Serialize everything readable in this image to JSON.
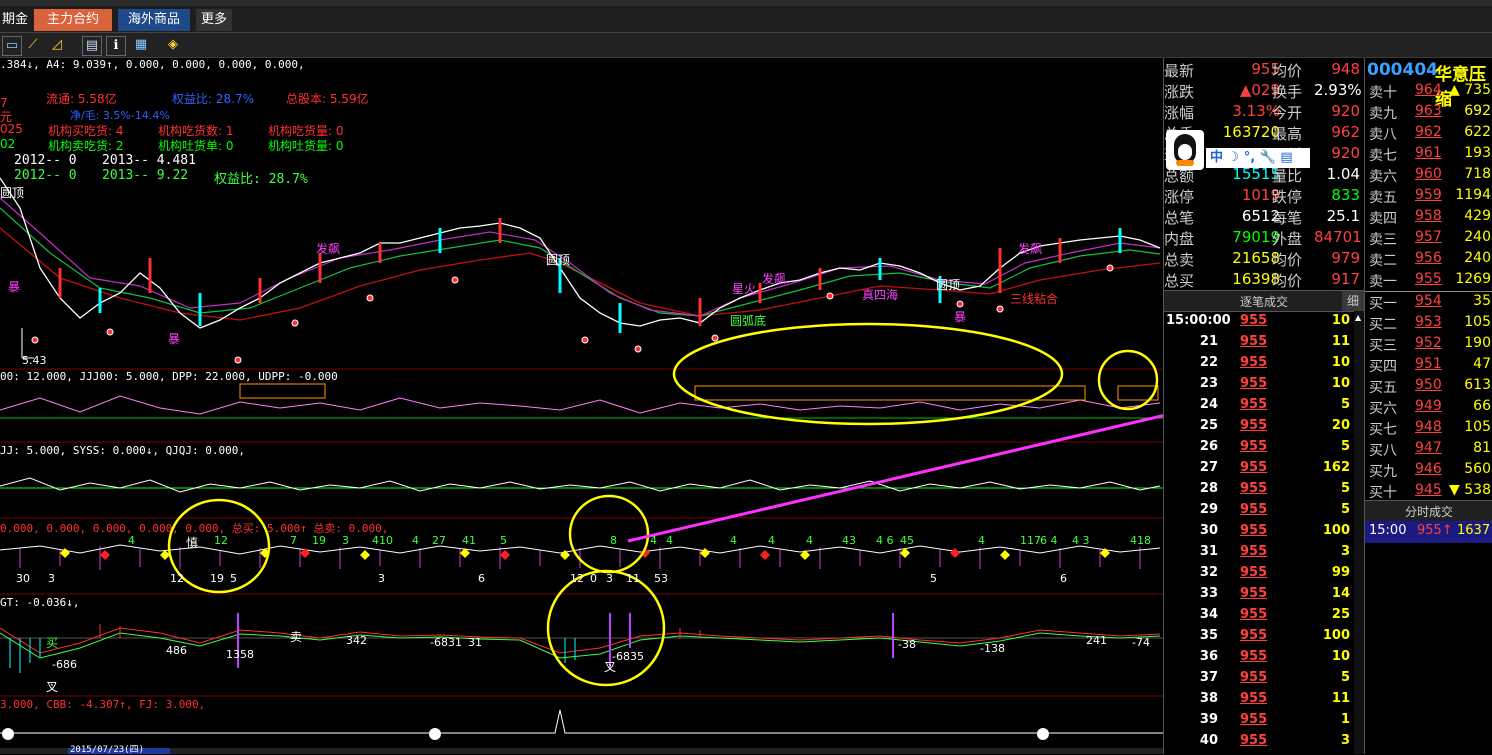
{
  "tabs": [
    {
      "label": "期金",
      "active": false
    },
    {
      "label": "主力合约",
      "active": true
    },
    {
      "label": "海外商品",
      "active": false
    },
    {
      "label": "更多",
      "active": false
    }
  ],
  "chart": {
    "topline": ".384↓, A4: 9.039↑, 0.000, 0.000, 0.000, 0.000,",
    "info": {
      "liutong": "流通: 5.58亿",
      "yiyibi": "权益比: 28.7%",
      "zongguben": "总股本: 5.59亿",
      "jingzi": "净/毛: 3.5%-14.4%",
      "l1": "机构买吃货: 4",
      "l2": "机构吃货数: 1",
      "l3": "机构吃货量: 0",
      "l4": "机构卖吃货: 2",
      "l5": "机构吐货单: 0",
      "l6": "机构吐货量: 0",
      "y1a": "2012-- 0",
      "y1b": "2013-- 4.481",
      "y2a": "2012-- 0",
      "y2b": "2013-- 9.22",
      "y2c": "权益比: 28.7%",
      "left_nums": [
        "7",
        "元",
        "025",
        "02"
      ]
    },
    "labels": {
      "yuanding": "圆顶",
      "fapiao": "发飙",
      "bao": "暴",
      "xinghuo": "星火",
      "yuanhudi": "圆弧底",
      "sanxian": "三线粘合",
      "zhenjia": "真四海",
      "low": "5.43"
    },
    "ind1": "00: 12.000, JJJ00: 5.000, DPP: 22.000, UDPP: -0.000",
    "ind2": "JJ: 5.000, SYSS: 0.000↓, QJQJ: 0.000,",
    "ind3": "0.000, 0.000, 0.000, 0.000, 0.000,  总买: 5.000↑  总卖: 0.000,",
    "ind4": "GT: -0.036↓,",
    "ind5": "3.000, CBB: -4.307↑, FJ: 3.000,",
    "ind3_labels": [
      "慎",
      "12",
      "4",
      "7",
      "19",
      "3",
      "410",
      "4",
      "27",
      "41",
      "5",
      "8",
      "4",
      "4",
      "4",
      "4",
      "4",
      "43",
      "4 6",
      "45",
      "4",
      "117",
      "6 4",
      "4 3",
      "418"
    ],
    "ind3_bottom": [
      "30",
      "3",
      "12",
      "19",
      "5",
      "3",
      "6",
      "12",
      "0",
      "3",
      "11",
      "53",
      "5",
      "6"
    ],
    "ind4_labels": {
      "n1": "-686",
      "n2": "486",
      "n3": "1358",
      "n4": "342",
      "n5": "-6831",
      "n6": "31",
      "n7": "-6835",
      "n8": "-38",
      "n9": "-138",
      "n10": "241",
      "n11": "-74",
      "b1": "买",
      "b2": "卖",
      "b3": "叉",
      "b4": "叉"
    },
    "date_bar": "2015/07/23(四)"
  },
  "quote": {
    "code": "000404",
    "name": "华意压缩",
    "rows": [
      {
        "l1": "最新",
        "v1": "955",
        "c1": "#ff4040",
        "l2": "均价",
        "v2": "948",
        "c2": "#ff4040"
      },
      {
        "l1": "涨跌",
        "v1": "▲029",
        "c1": "#ff4040",
        "l2": "换手",
        "v2": "2.93%",
        "c2": "#ffffff"
      },
      {
        "l1": "涨幅",
        "v1": "3.13%",
        "c1": "#ff4040",
        "l2": "今开",
        "v2": "920",
        "c2": "#ff4040"
      },
      {
        "l1": "总手",
        "v1": "163720",
        "c1": "#ffff00",
        "l2": "最高",
        "v2": "962",
        "c2": "#ff4040"
      },
      {
        "l1": "现手",
        "v1": "",
        "c1": "#ffff00",
        "l2": "最低",
        "v2": "920",
        "c2": "#ff4040"
      },
      {
        "l1": "总额",
        "v1": "15515",
        "c1": "#00ffff",
        "l2": "量比",
        "v2": "1.04",
        "c2": "#ffffff"
      },
      {
        "l1": "涨停",
        "v1": "1019",
        "c1": "#ff4040",
        "l2": "跌停",
        "v2": "833",
        "c2": "#00ff00"
      },
      {
        "l1": "总笔",
        "v1": "6512",
        "c1": "#ffffff",
        "l2": "每笔",
        "v2": "25.1",
        "c2": "#ffffff"
      },
      {
        "l1": "内盘",
        "v1": "79019",
        "c1": "#00ff00",
        "l2": "外盘",
        "v2": "84701",
        "c2": "#ff4040"
      },
      {
        "l1": "总卖",
        "v1": "21658",
        "c1": "#ffff00",
        "l2": "均价",
        "v2": "979",
        "c2": "#ff4040"
      },
      {
        "l1": "总买",
        "v1": "16398",
        "c1": "#ffff00",
        "l2": "均价",
        "v2": "917",
        "c2": "#ff4040"
      }
    ],
    "qq_bar": "中 ☽ °, 🔧 ▤",
    "tick_header": "逐笔成交",
    "tick_detail": "细",
    "ticks": [
      {
        "t": "15:00:00",
        "p": "955",
        "v": "10"
      },
      {
        "t": "21",
        "p": "955",
        "v": "11"
      },
      {
        "t": "22",
        "p": "955",
        "v": "10"
      },
      {
        "t": "23",
        "p": "955",
        "v": "10"
      },
      {
        "t": "24",
        "p": "955",
        "v": "5"
      },
      {
        "t": "25",
        "p": "955",
        "v": "20"
      },
      {
        "t": "26",
        "p": "955",
        "v": "5"
      },
      {
        "t": "27",
        "p": "955",
        "v": "162"
      },
      {
        "t": "28",
        "p": "955",
        "v": "5"
      },
      {
        "t": "29",
        "p": "955",
        "v": "5"
      },
      {
        "t": "30",
        "p": "955",
        "v": "100"
      },
      {
        "t": "31",
        "p": "955",
        "v": "3"
      },
      {
        "t": "32",
        "p": "955",
        "v": "99"
      },
      {
        "t": "33",
        "p": "955",
        "v": "14"
      },
      {
        "t": "34",
        "p": "955",
        "v": "25"
      },
      {
        "t": "35",
        "p": "955",
        "v": "100"
      },
      {
        "t": "36",
        "p": "955",
        "v": "10"
      },
      {
        "t": "37",
        "p": "955",
        "v": "5"
      },
      {
        "t": "38",
        "p": "955",
        "v": "11"
      },
      {
        "t": "39",
        "p": "955",
        "v": "1"
      },
      {
        "t": "40",
        "p": "955",
        "v": "3"
      }
    ]
  },
  "orderbook": {
    "sells": [
      {
        "l": "卖十",
        "p": "964",
        "v": "▲ 735"
      },
      {
        "l": "卖九",
        "p": "963",
        "v": "692"
      },
      {
        "l": "卖八",
        "p": "962",
        "v": "622"
      },
      {
        "l": "卖七",
        "p": "961",
        "v": "193"
      },
      {
        "l": "卖六",
        "p": "960",
        "v": "718"
      },
      {
        "l": "卖五",
        "p": "959",
        "v": "1194"
      },
      {
        "l": "卖四",
        "p": "958",
        "v": "429"
      },
      {
        "l": "卖三",
        "p": "957",
        "v": "240"
      },
      {
        "l": "卖二",
        "p": "956",
        "v": "240"
      },
      {
        "l": "卖一",
        "p": "955",
        "v": "1269"
      }
    ],
    "buys": [
      {
        "l": "买一",
        "p": "954",
        "v": "35"
      },
      {
        "l": "买二",
        "p": "953",
        "v": "105"
      },
      {
        "l": "买三",
        "p": "952",
        "v": "190"
      },
      {
        "l": "买四",
        "p": "951",
        "v": "47"
      },
      {
        "l": "买五",
        "p": "950",
        "v": "613"
      },
      {
        "l": "买六",
        "p": "949",
        "v": "66"
      },
      {
        "l": "买七",
        "p": "948",
        "v": "105"
      },
      {
        "l": "买八",
        "p": "947",
        "v": "81"
      },
      {
        "l": "买九",
        "p": "946",
        "v": "560"
      },
      {
        "l": "买十",
        "p": "945",
        "v": "▼ 538"
      }
    ],
    "minute_header": "分时成交",
    "minute": {
      "t": "15:00",
      "p": "955↑",
      "v": "1637"
    }
  }
}
